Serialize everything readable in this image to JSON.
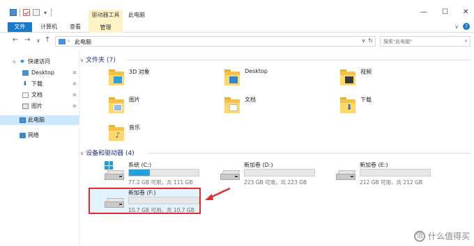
{
  "window": {
    "title": "此电脑",
    "context_tab": "驱动器工具",
    "min": "—",
    "max": "☐",
    "close": "✕"
  },
  "ribbon": {
    "tabs": [
      "文件",
      "计算机",
      "查看",
      "管理"
    ],
    "help": "?",
    "expand": "∨"
  },
  "nav": {
    "back": "←",
    "forward": "→",
    "recent": "∨",
    "up": "↑",
    "path_sep": "›",
    "path": "此电脑",
    "dropdown": "∨",
    "refresh": "↻",
    "search_placeholder": "搜索\"此电脑\"",
    "search_icon": "⌕"
  },
  "sidebar": {
    "quick_access": "快速访问",
    "pin": "✲",
    "items": [
      {
        "label": "Desktop",
        "icon": "desktop-icon"
      },
      {
        "label": "下载",
        "icon": "download-icon"
      },
      {
        "label": "文档",
        "icon": "document-icon"
      },
      {
        "label": "图片",
        "icon": "pictures-icon"
      }
    ],
    "this_pc": "此电脑",
    "network": "网络"
  },
  "folders_group": {
    "title": "文件夹 (7)",
    "items": [
      {
        "label": "3D 对象",
        "icon": "3d-objects-icon"
      },
      {
        "label": "Desktop",
        "icon": "desktop-folder-icon"
      },
      {
        "label": "视频",
        "icon": "video-folder-icon"
      },
      {
        "label": "图片",
        "icon": "pictures-folder-icon"
      },
      {
        "label": "文档",
        "icon": "documents-folder-icon"
      },
      {
        "label": "下载",
        "icon": "downloads-folder-icon"
      },
      {
        "label": "音乐",
        "icon": "music-folder-icon"
      }
    ]
  },
  "drives_group": {
    "title": "设备和驱动器 (4)",
    "items": [
      {
        "label": "系统 (C:)",
        "info": "77.2 GB 可用，共 111 GB",
        "used_fraction": 0.3
      },
      {
        "label": "新加卷 (D:)",
        "info": "223 GB 可用，共 223 GB",
        "used_fraction": 0.0
      },
      {
        "label": "新加卷 (E:)",
        "info": "212 GB 可用，共 212 GB",
        "used_fraction": 0.0
      },
      {
        "label": "新加卷 (F:)",
        "info": "10.7 GB 可用，共 10.7 GB",
        "used_fraction": 0.0
      }
    ]
  },
  "colors": {
    "accent": "#1979ca",
    "highlight_border": "#e52a2a",
    "drive_fill": "#26a0da",
    "folder": "#ffd866"
  },
  "watermark": {
    "icon": "值",
    "text": "什么值得买"
  }
}
